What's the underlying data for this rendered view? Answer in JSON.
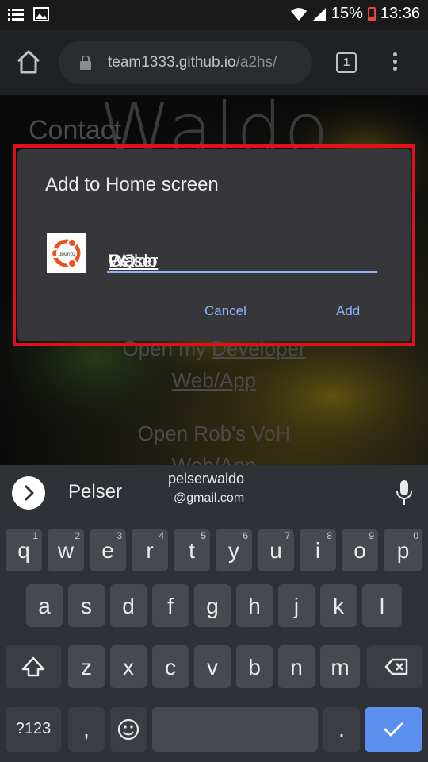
{
  "status_bar": {
    "battery": "15%",
    "time": "13:36"
  },
  "browser": {
    "url_host": "team1333.github.io",
    "url_path": "/a2hs/",
    "tab_count": "1"
  },
  "page": {
    "title": "Waldo",
    "heading": "Contact",
    "link1_prefix": "Open my ",
    "link1_underlined": "Developer",
    "link1_line2": "Web/App",
    "link2_line1": "Open Rob's VoH",
    "link2_line2": "Web/App"
  },
  "dialog": {
    "title": "Add to Home screen",
    "name_part1": "Waldo ",
    "name_part2": "OQ",
    "name_part3": " ",
    "name_part4": "Pelser",
    "icon_text": "ubuntu",
    "cancel_label": "Cancel",
    "add_label": "Add",
    "highlight_color": "#e2101a"
  },
  "suggestions": {
    "first": "Pelser",
    "second_line1": "pelserwaldo",
    "second_line2": "@gmail.com"
  },
  "keyboard": {
    "row1": [
      {
        "key": "q",
        "hint": "1"
      },
      {
        "key": "w",
        "hint": "2"
      },
      {
        "key": "e",
        "hint": "3"
      },
      {
        "key": "r",
        "hint": "4"
      },
      {
        "key": "t",
        "hint": "5"
      },
      {
        "key": "y",
        "hint": "6"
      },
      {
        "key": "u",
        "hint": "7"
      },
      {
        "key": "i",
        "hint": "8"
      },
      {
        "key": "o",
        "hint": "9"
      },
      {
        "key": "p",
        "hint": "0"
      }
    ],
    "row2": [
      "a",
      "s",
      "d",
      "f",
      "g",
      "h",
      "j",
      "k",
      "l"
    ],
    "row3": [
      "z",
      "x",
      "c",
      "v",
      "b",
      "n",
      "m"
    ],
    "symbols_label": "?123",
    "comma_label": ",",
    "period_label": ".",
    "accent_color": "#5b8ff0"
  }
}
